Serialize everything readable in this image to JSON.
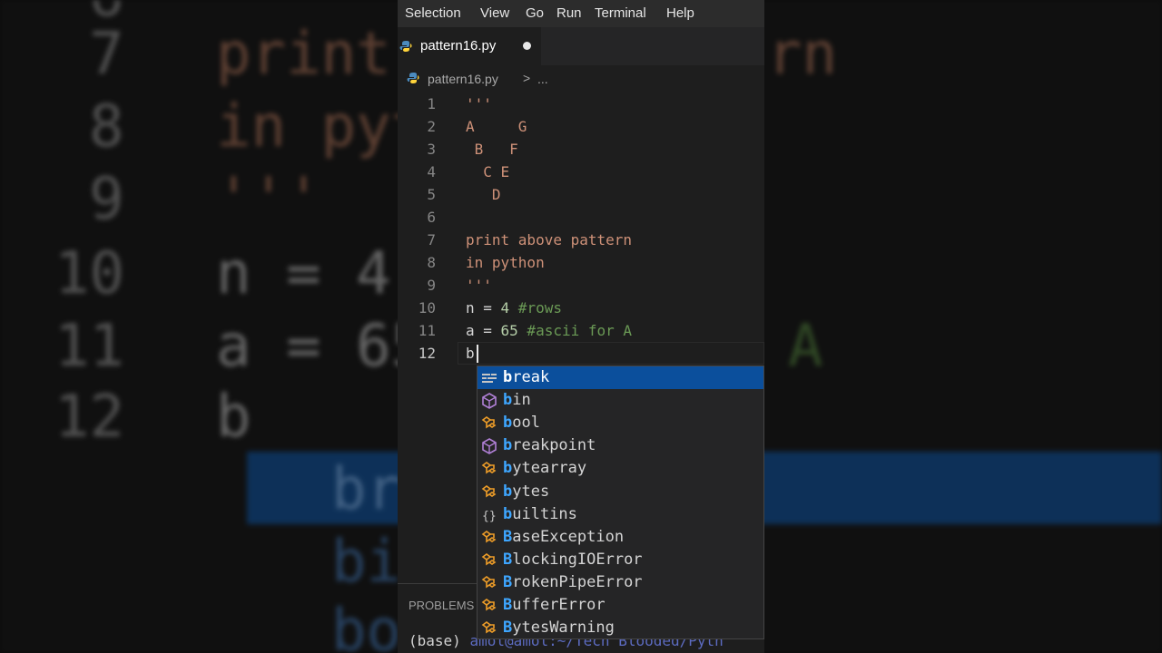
{
  "menu": [
    "Selection",
    "View",
    "Go",
    "Run",
    "Terminal",
    "Help"
  ],
  "tab": {
    "title": "pattern16.py",
    "modified": true
  },
  "breadcrumb": {
    "file": "pattern16.py",
    "separator": ">",
    "more": "..."
  },
  "code_lines": [
    {
      "n": "1",
      "text": "'''",
      "style": "str"
    },
    {
      "n": "2",
      "text": "A     G",
      "style": "str"
    },
    {
      "n": "3",
      "text": " B   F",
      "style": "str"
    },
    {
      "n": "4",
      "text": "  C E",
      "style": "str"
    },
    {
      "n": "5",
      "text": "   D",
      "style": "str"
    },
    {
      "n": "6",
      "text": "",
      "style": "str"
    },
    {
      "n": "7",
      "text": "print above pattern",
      "style": "str"
    },
    {
      "n": "8",
      "text": "in python",
      "style": "str"
    },
    {
      "n": "9",
      "text": "'''",
      "style": "str"
    },
    {
      "n": "10",
      "parts": [
        [
          "n = ",
          "plain"
        ],
        [
          "4",
          "num"
        ],
        [
          " #rows",
          "cmt"
        ]
      ]
    },
    {
      "n": "11",
      "parts": [
        [
          "a = ",
          "plain"
        ],
        [
          "65",
          "num"
        ],
        [
          " #ascii for A",
          "cmt"
        ]
      ]
    },
    {
      "n": "12",
      "text": "b",
      "style": "plain",
      "active": true
    }
  ],
  "suggestions": [
    {
      "label": "break",
      "prefix": 1,
      "kind": "keyword",
      "selected": true
    },
    {
      "label": "bin",
      "prefix": 1,
      "kind": "function"
    },
    {
      "label": "bool",
      "prefix": 1,
      "kind": "class"
    },
    {
      "label": "breakpoint",
      "prefix": 1,
      "kind": "function"
    },
    {
      "label": "bytearray",
      "prefix": 1,
      "kind": "class"
    },
    {
      "label": "bytes",
      "prefix": 1,
      "kind": "class"
    },
    {
      "label": "builtins",
      "prefix": 1,
      "kind": "module"
    },
    {
      "label": "BaseException",
      "prefix": 1,
      "kind": "class"
    },
    {
      "label": "BlockingIOError",
      "prefix": 1,
      "kind": "class"
    },
    {
      "label": "BrokenPipeError",
      "prefix": 1,
      "kind": "class"
    },
    {
      "label": "BufferError",
      "prefix": 1,
      "kind": "class"
    },
    {
      "label": "BytesWarning",
      "prefix": 1,
      "kind": "class"
    }
  ],
  "panel": {
    "tab": "PROBLEMS",
    "prompt": "(base)",
    "path": "amol@amol:~/Tech Blooded/Pyth"
  },
  "backdrop": {
    "lines": [
      {
        "n": "7",
        "text": "print"
      },
      {
        "n": "8",
        "text": "in pyt"
      },
      {
        "n": "9",
        "text": "'''"
      },
      {
        "n": "10",
        "text": "n = 4"
      },
      {
        "n": "11",
        "text": "a = 65"
      },
      {
        "n": "12",
        "text": "b"
      }
    ],
    "right_fragments": [
      "rn",
      "A"
    ],
    "suggest_fragments": [
      "br",
      "bi",
      "bo"
    ]
  },
  "colors": {
    "accent_selection": "#0b4f9c",
    "string": "#ce9178",
    "number": "#b5cea8",
    "comment": "#6a9955",
    "match_highlight": "#3ea6ff"
  }
}
